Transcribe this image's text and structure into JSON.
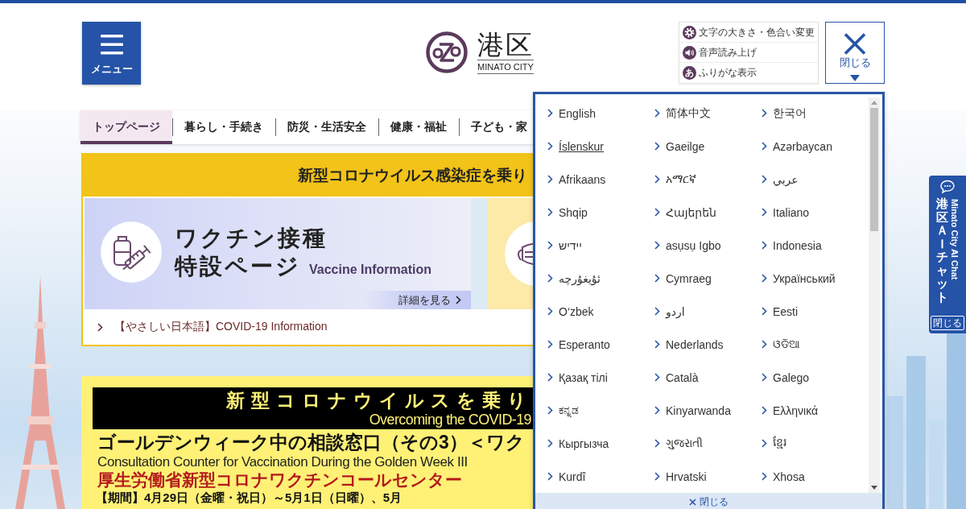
{
  "header": {
    "menu_button": "メニュー",
    "logo": {
      "name": "港区",
      "latin_name": "MINATO CITY"
    },
    "tools": [
      {
        "kind": "gear",
        "label": "文字の大きさ・色合い変更"
      },
      {
        "kind": "speaker",
        "label": "音声読み上げ"
      },
      {
        "kind": "glyph",
        "glyph": "あ",
        "label": "ふりがな表示"
      }
    ],
    "close_button": "閉じる"
  },
  "nav": [
    {
      "label": "トップページ",
      "selected": true
    },
    {
      "label": "暮らし・手続き",
      "selected": false
    },
    {
      "label": "防災・生活安全",
      "selected": false
    },
    {
      "label": "健康・福祉",
      "selected": false
    },
    {
      "label": "子ども・家",
      "selected": false
    }
  ],
  "covid_card": {
    "heading": "新型コロナウイルス感染症を乗り",
    "vaccine_banner": {
      "title_line_1": "ワクチン接種",
      "title_line_2": "特設ページ",
      "subtitle": "Vaccine Information",
      "details_link": "詳細を見る"
    },
    "link": "【やさしい日本語】COVID-19 Information"
  },
  "poster": {
    "banner_title": "新型コロナウイルスを乗り",
    "banner_subtitle": "Overcoming the COVID-19",
    "heading": "ゴールデンウィーク中の相談窓口（その3）＜ワク",
    "heading_en": "Consultation Counter for Vaccination During the Golden Week III",
    "call_center": "厚生労働省新型コロナワクチンコールセンター",
    "period": "【期間】4月29日（金曜・祝日）～5月1日（日曜）、5月"
  },
  "language_menu": {
    "languages": [
      {
        "label": "English",
        "hovered": false
      },
      {
        "label": "简体中文",
        "hovered": false
      },
      {
        "label": "한국어",
        "hovered": false
      },
      {
        "label": "Íslenskur",
        "hovered": true
      },
      {
        "label": "Gaeilge",
        "hovered": false
      },
      {
        "label": "Azərbaycan",
        "hovered": false
      },
      {
        "label": "Afrikaans",
        "hovered": false
      },
      {
        "label": "አማርኛ",
        "hovered": false
      },
      {
        "label": "عربي",
        "hovered": false
      },
      {
        "label": "Shqip",
        "hovered": false
      },
      {
        "label": "Հայերեն",
        "hovered": false
      },
      {
        "label": "Italiano",
        "hovered": false
      },
      {
        "label": "יידיש",
        "hovered": false
      },
      {
        "label": "asụsụ Igbo",
        "hovered": false
      },
      {
        "label": "Indonesia",
        "hovered": false
      },
      {
        "label": "ئۇيغۇرچە",
        "hovered": false
      },
      {
        "label": "Cymraeg",
        "hovered": false
      },
      {
        "label": "Український",
        "hovered": false
      },
      {
        "label": "O‘zbek",
        "hovered": false
      },
      {
        "label": "اردو",
        "hovered": false
      },
      {
        "label": "Eesti",
        "hovered": false
      },
      {
        "label": "Esperanto",
        "hovered": false
      },
      {
        "label": "Nederlands",
        "hovered": false
      },
      {
        "label": "ଓଡିଆ",
        "hovered": false
      },
      {
        "label": "Қазақ тілі",
        "hovered": false
      },
      {
        "label": "Català",
        "hovered": false
      },
      {
        "label": "Galego",
        "hovered": false
      },
      {
        "label": "ಕನ್ನಡ",
        "hovered": false
      },
      {
        "label": "Kinyarwanda",
        "hovered": false
      },
      {
        "label": "Ελληνικά",
        "hovered": false
      },
      {
        "label": "Кыргызча",
        "hovered": false
      },
      {
        "label": "ગુજરાતી",
        "hovered": false
      },
      {
        "label": "ខ្មែរ",
        "hovered": false
      },
      {
        "label": "Kurdî",
        "hovered": false
      },
      {
        "label": "Hrvatski",
        "hovered": false
      },
      {
        "label": "Xhosa",
        "hovered": false
      }
    ],
    "close_label": "閉じる"
  },
  "chat_widget": {
    "title": "港区ＡＩチャット",
    "subtitle": "Minato City AI Chat",
    "close_label": "閉じる"
  }
}
